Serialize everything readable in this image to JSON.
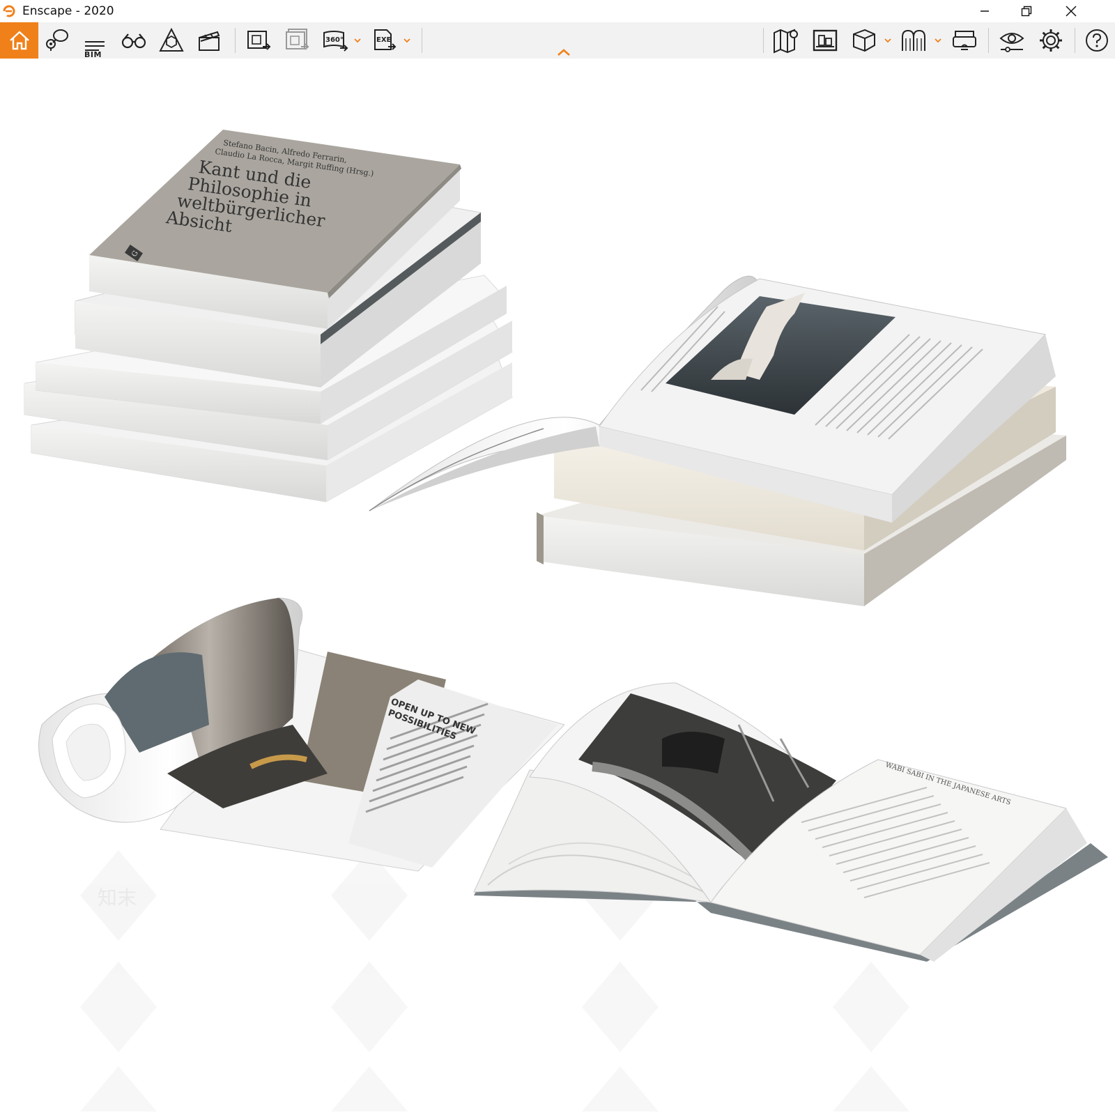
{
  "window": {
    "title": "Enscape - 2020"
  },
  "toolbar": {
    "bim_label": "BIM",
    "badge_360": "360°",
    "badge_exe": "EXE"
  },
  "scene": {
    "book_cover": {
      "authors_line1": "Stefano Bacin, Alfredo Ferrarin,",
      "authors_line2": "Claudio La Rocca, Margit Ruffing (Hrsg.)",
      "title_line1": "Kant und die",
      "title_line2": "Philosophie in",
      "title_line3": "weltbürgerlicher",
      "title_line4": "Absicht",
      "publisher_mark": "G"
    },
    "magazine_headline_line1": "OPEN UP TO NEW",
    "magazine_headline_line2": "POSSIBILITIES",
    "book_header": "WABI SABI IN THE JAPANESE ARTS",
    "watermark": "知末"
  },
  "icons": [
    "home-icon",
    "location-pin-icon",
    "bim-icon",
    "binoculars-icon",
    "view-cube-icon",
    "clapper-icon",
    "render-screenshot-icon",
    "batch-render-icon",
    "panorama-360-icon",
    "export-exe-icon",
    "map-icon",
    "asset-library-icon",
    "box-icon",
    "arches-icon",
    "vr-headset-icon",
    "eye-settings-icon",
    "gear-icon",
    "help-icon",
    "collapse-chevron-icon"
  ],
  "colors": {
    "accent": "#f08019",
    "toolbar_bg": "#f2f2f2"
  }
}
